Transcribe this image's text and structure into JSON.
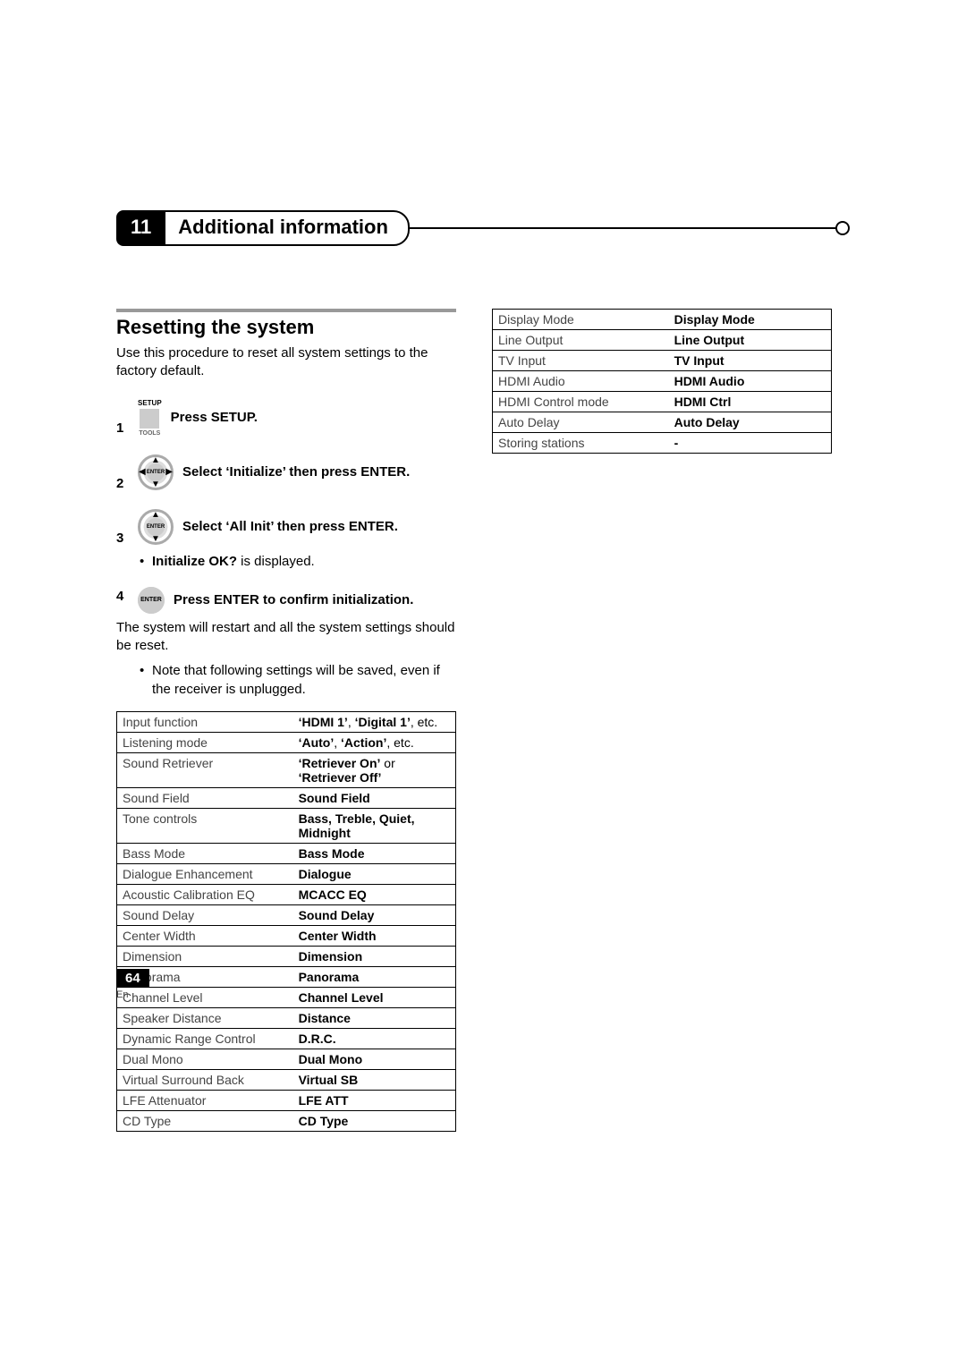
{
  "chapter": {
    "number": "11",
    "title": "Additional information"
  },
  "section": {
    "title": "Resetting the system",
    "intro": "Use this procedure to reset all system settings to the factory default."
  },
  "steps": {
    "s1": {
      "num": "1",
      "text": "Press SETUP.",
      "icon_top": "SETUP",
      "icon_bottom": "TOOLS"
    },
    "s2": {
      "num": "2",
      "text": "Select ‘Initialize’ then press ENTER.",
      "icon_label": "ENTER"
    },
    "s3": {
      "num": "3",
      "text": "Select ‘All Init’ then press ENTER.",
      "icon_label": "ENTER",
      "bullet_bold": "Initialize OK?",
      "bullet_rest": " is displayed."
    },
    "s4": {
      "num": "4",
      "text": "Press ENTER to confirm initialization.",
      "icon_label": "ENTER",
      "after": "The system will restart and all the system settings should be reset.",
      "note": "Note that following settings will be saved, even if the receiver is unplugged."
    }
  },
  "table1": [
    {
      "l": "Input function",
      "r_bold": "‘HDMI 1’",
      "r_mid": ", ",
      "r_bold2": "‘Digital 1’",
      "r_suffix": ", etc."
    },
    {
      "l": "Listening mode",
      "r_bold": "‘Auto’",
      "r_mid": ", ",
      "r_bold2": "‘Action’",
      "r_suffix": ", etc."
    },
    {
      "l": "Sound Retriever",
      "r_bold": "‘Retriever On’",
      "r_mid": " or ",
      "r_bold2": "‘Retriever Off’",
      "r_suffix": ""
    },
    {
      "l": "Sound Field",
      "r": "Sound Field"
    },
    {
      "l": "Tone controls",
      "r": "Bass, Treble, Quiet, Midnight"
    },
    {
      "l": "Bass Mode",
      "r": "Bass Mode"
    },
    {
      "l": "Dialogue Enhancement",
      "r": "Dialogue"
    },
    {
      "l": "Acoustic Calibration EQ",
      "r": "MCACC EQ"
    },
    {
      "l": "Sound Delay",
      "r": "Sound Delay"
    },
    {
      "l": "Center Width",
      "r": "Center Width"
    },
    {
      "l": "Dimension",
      "r": "Dimension"
    },
    {
      "l": "Panorama",
      "r": "Panorama"
    },
    {
      "l": "Channel Level",
      "r": "Channel Level"
    },
    {
      "l": "Speaker Distance",
      "r": "Distance"
    },
    {
      "l": "Dynamic Range Control",
      "r": "D.R.C."
    },
    {
      "l": "Dual Mono",
      "r": "Dual Mono"
    },
    {
      "l": "Virtual Surround Back",
      "r": "Virtual SB"
    },
    {
      "l": "LFE Attenuator",
      "r": "LFE ATT"
    },
    {
      "l": "CD Type",
      "r": "CD Type"
    }
  ],
  "table2": [
    {
      "l": "Display Mode",
      "r": "Display Mode"
    },
    {
      "l": "Line Output",
      "r": "Line Output"
    },
    {
      "l": "TV Input",
      "r": "TV Input"
    },
    {
      "l": "HDMI Audio",
      "r": "HDMI Audio"
    },
    {
      "l": "HDMI Control mode",
      "r": "HDMI Ctrl"
    },
    {
      "l": "Auto Delay",
      "r": "Auto Delay"
    },
    {
      "l": "Storing stations",
      "r": "-"
    }
  ],
  "footer": {
    "page": "64",
    "lang": "En"
  }
}
